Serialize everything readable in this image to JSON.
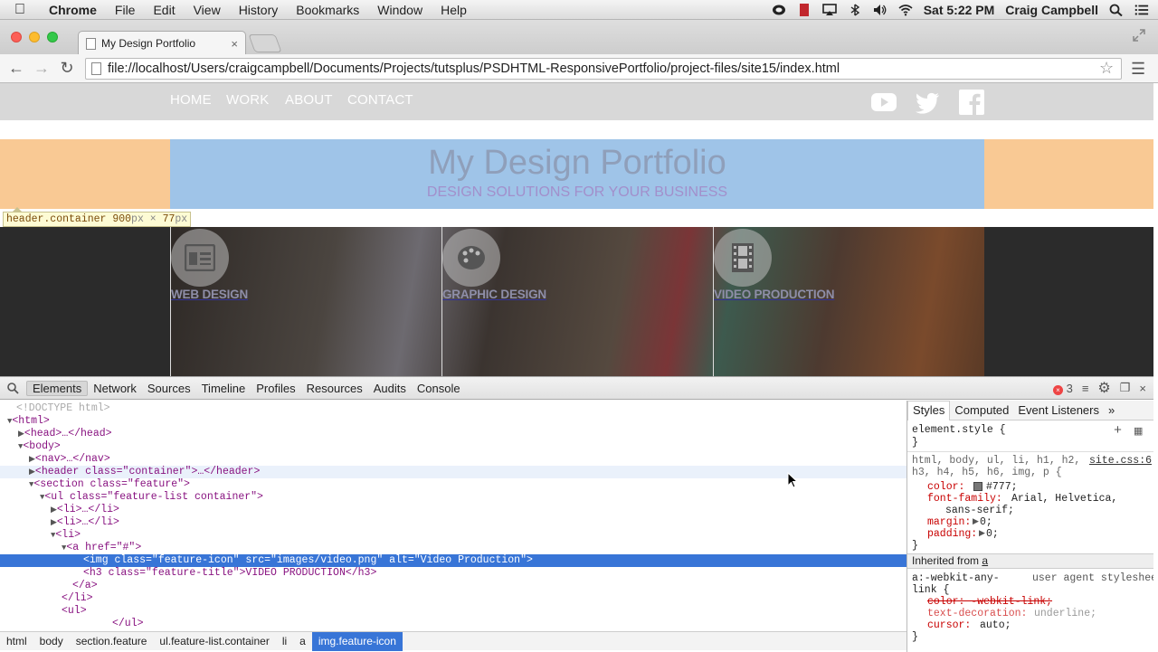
{
  "menubar": {
    "app": "Chrome",
    "items": [
      "File",
      "Edit",
      "View",
      "History",
      "Bookmarks",
      "Window",
      "Help"
    ],
    "clock": "Sat 5:22 PM",
    "user": "Craig Campbell"
  },
  "tab": {
    "title": "My Design Portfolio",
    "close": "×"
  },
  "address": {
    "url": "file://localhost/Users/craigcampbell/Documents/Projects/tutsplus/PSDHTML-ResponsivePortfolio/project-files/site15/index.html"
  },
  "site": {
    "nav": [
      "HOME",
      "WORK",
      "ABOUT",
      "CONTACT"
    ],
    "title": "My Design Portfolio",
    "subtitle": "DESIGN SOLUTIONS FOR YOUR BUSINESS",
    "tooltip": {
      "selector": "header.container",
      "w": "900",
      "h": "77",
      "unit": "px",
      "x": " × "
    },
    "features": [
      "WEB DESIGN",
      "GRAPHIC DESIGN",
      "VIDEO PRODUCTION"
    ]
  },
  "devtools": {
    "tabs": [
      "Elements",
      "Network",
      "Sources",
      "Timeline",
      "Profiles",
      "Resources",
      "Audits",
      "Console"
    ],
    "errors": "3",
    "dom": [
      "<!DOCTYPE html>",
      "<html>",
      "<head>…</head>",
      "<body>",
      "<nav>…</nav>",
      "<header class=\"container\">…</header>",
      "<section class=\"feature\">",
      "<ul class=\"feature-list container\">",
      "<li>…</li>",
      "<li>…</li>",
      "<li>",
      "<a href=\"#\">",
      "<img class=\"feature-icon\" src=\"images/video.png\" alt=\"Video Production\">",
      "<h3 class=\"feature-title\">VIDEO PRODUCTION</h3>",
      "</a>",
      "</li>",
      "<ul>",
      "</ul>"
    ],
    "breadcrumbs": [
      "html",
      "body",
      "section.feature",
      "ul.feature-list.container",
      "li",
      "a",
      "img.feature-icon"
    ],
    "styles": {
      "tabs": [
        "Styles",
        "Computed",
        "Event Listeners",
        "»"
      ],
      "lines": [
        "element.style {",
        "}",
        "html, body, ul, li, h1, h2,",
        "h3, h4, h5, h6, img, p {",
        "color:",
        "#777;",
        "font-family:",
        "Arial, Helvetica,",
        "sans-serif;",
        "margin:",
        "0;",
        "padding:",
        "0;",
        "}",
        "Inherited from",
        "a",
        "a:-webkit-any-",
        "user agent stylesheet",
        "link {",
        "color: -webkit-link;",
        "text-decoration:",
        "underline;",
        "cursor:",
        "auto;",
        "}",
        "site.css:6"
      ]
    }
  }
}
